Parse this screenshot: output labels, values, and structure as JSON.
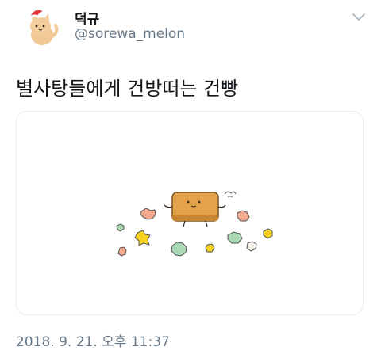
{
  "tweet": {
    "author": {
      "display_name": "덕규",
      "handle": "@sorewa_melon",
      "avatar_icon": "cat-santa-avatar"
    },
    "text": "별사탕들에게 건방떠는 건빵",
    "media": {
      "image_icon": "geonbbang-illustration"
    },
    "timestamp": "2018. 9. 21. 오후 11:37",
    "menu_icon": "chevron-down-icon"
  },
  "colors": {
    "text_primary": "#14171a",
    "text_secondary": "#657786",
    "border": "#e6ecf0",
    "cracker": "#e3a34a",
    "star_yellow": "#f5d21f",
    "star_pink": "#f3a98e",
    "star_green": "#a9d8b4",
    "star_white": "#f4f1ea"
  }
}
